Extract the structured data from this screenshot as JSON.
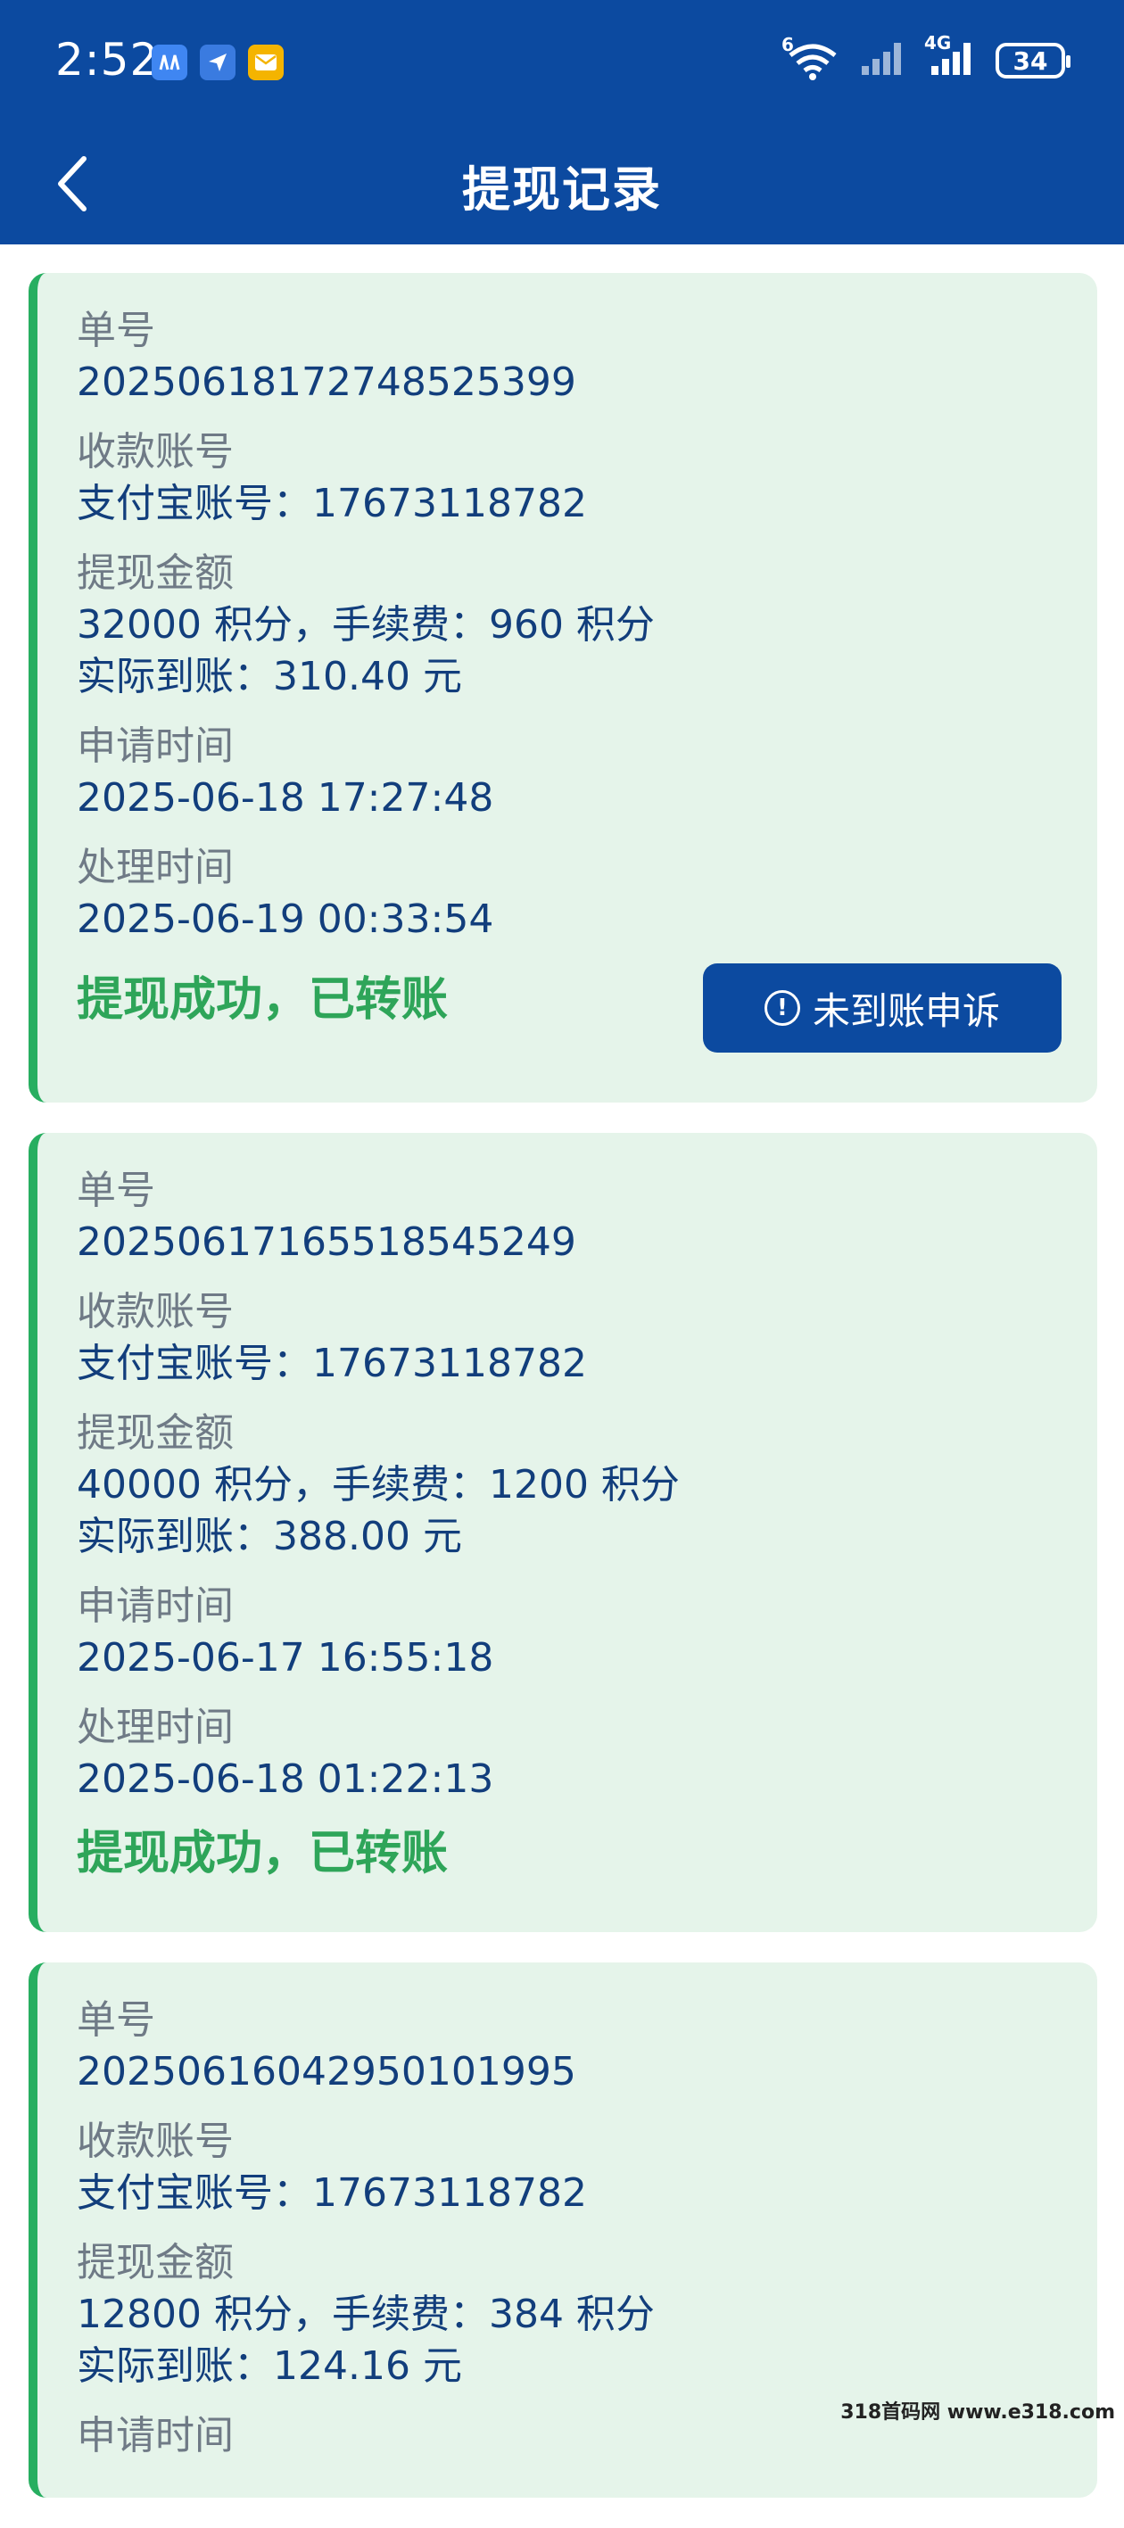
{
  "status_bar": {
    "time": "2:52",
    "notif_icons": [
      "app-icon",
      "send-icon",
      "mail-icon"
    ],
    "network_tag_wifi": "6",
    "network_tag_cell": "4G",
    "battery": "34"
  },
  "header": {
    "title": "提现记录"
  },
  "labels": {
    "order_no": "单号",
    "account": "收款账号",
    "amount": "提现金额",
    "apply_time": "申请时间",
    "process_time": "处理时间"
  },
  "records": [
    {
      "order_no": "2025061817274852539 9",
      "account": "支付宝账号：17673118782",
      "amount": "32000 积分，手续费：960 积分",
      "received": "实际到账：310.40 元",
      "apply_time": "2025-06-18 17:27:48",
      "process_time": "2025-06-19 00:33:54",
      "status": "提现成功，已转账",
      "appeal_label": "未到账申诉"
    },
    {
      "order_no": "20250617165518545249",
      "account": "支付宝账号：17673118782",
      "amount": "40000 积分，手续费：1200 积分",
      "received": "实际到账：388.00 元",
      "apply_time": "2025-06-17 16:55:18",
      "process_time": "2025-06-18 01:22:13",
      "status": "提现成功，已转账"
    },
    {
      "order_no": "20250616042950101995",
      "account": "支付宝账号：17673118782",
      "amount": "12800 积分，手续费：384 积分",
      "received": "实际到账：124.16 元",
      "apply_time_label_partial": "申请时间"
    }
  ],
  "watermark": "318首码网 www.e318.com",
  "colors": {
    "brand": "#0c4aa0",
    "card_bg": "#e5f4ea",
    "success": "#2ea559",
    "text": "#123e7c",
    "label": "#6f7a86"
  }
}
